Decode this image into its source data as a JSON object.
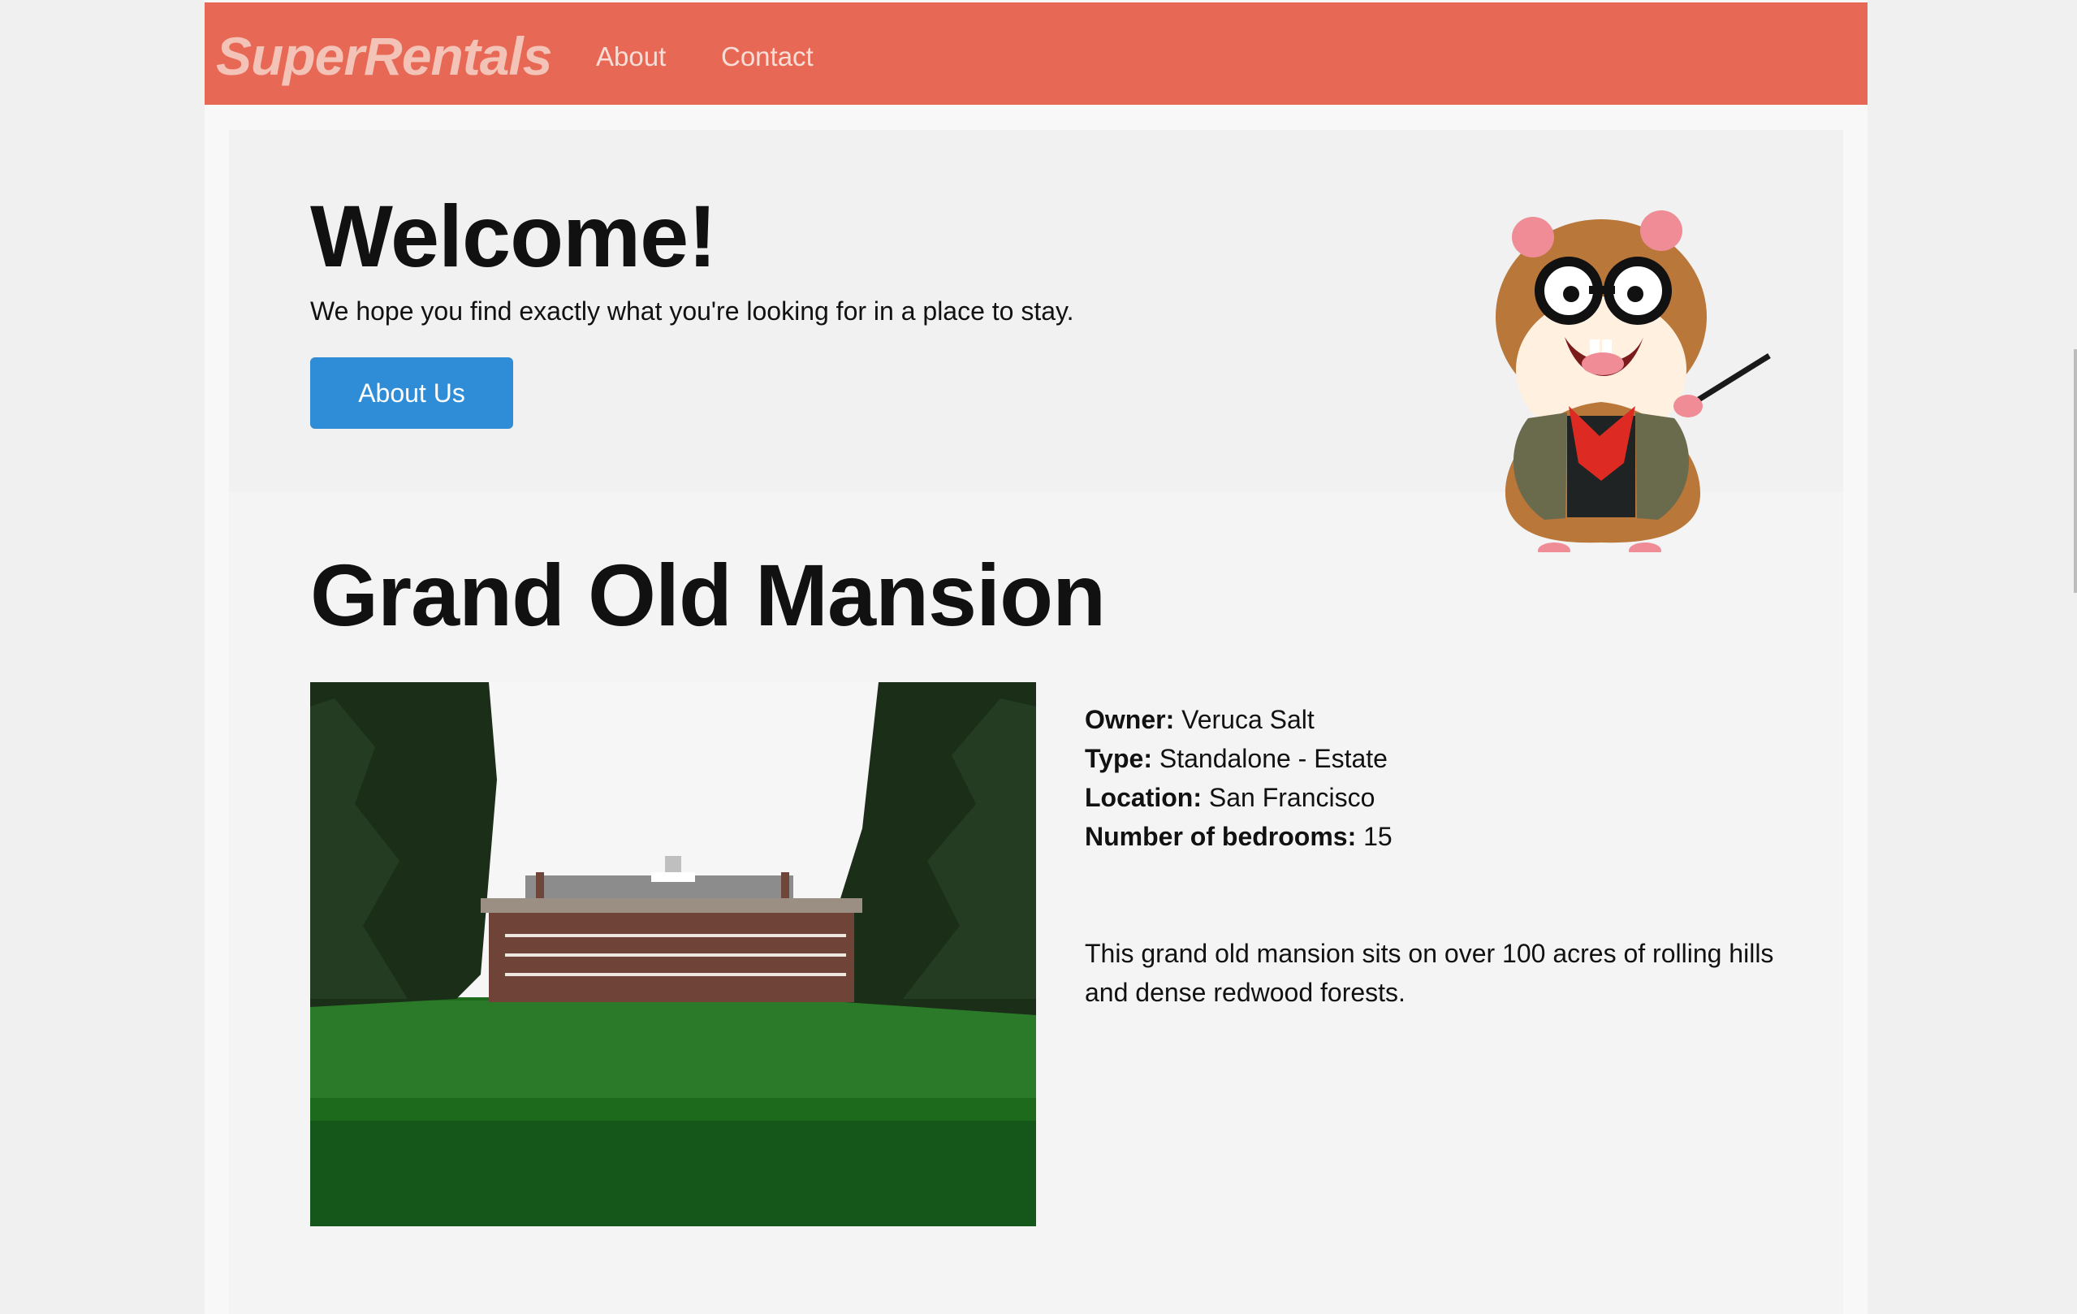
{
  "nav": {
    "brand": "SuperRentals",
    "about": "About",
    "contact": "Contact"
  },
  "jumbo": {
    "title": "Welcome!",
    "subtitle": "We hope you find exactly what you're looking for in a place to stay.",
    "button": "About Us"
  },
  "rental": {
    "title": "Grand Old Mansion",
    "owner_label": "Owner:",
    "owner": "Veruca Salt",
    "type_label": "Type:",
    "type": "Standalone - Estate",
    "location_label": "Location:",
    "location": "San Francisco",
    "bedrooms_label": "Number of bedrooms:",
    "bedrooms": "15",
    "description": "This grand old mansion sits on over 100 acres of rolling hills and dense redwood forests."
  },
  "colors": {
    "topbar": "#e76955",
    "button": "#2f8cd7"
  },
  "icons": {
    "mascot": "tomster-hamster-professor-icon"
  }
}
